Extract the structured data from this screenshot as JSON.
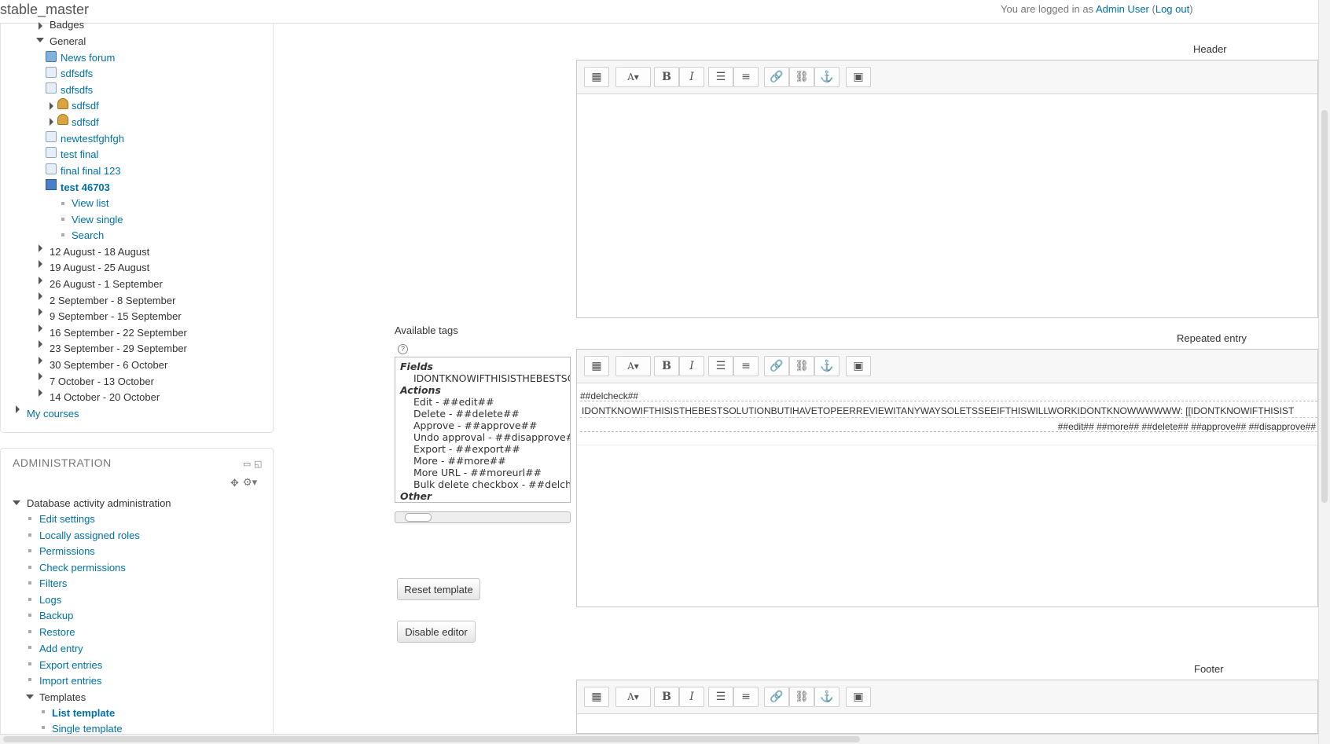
{
  "topbar": {
    "site_name": "stable_master",
    "login_prefix": "You are logged in as ",
    "user_name": "Admin User",
    "logout_open": " (",
    "logout_label": "Log out",
    "logout_close": ")"
  },
  "nav": {
    "badges": "Badges",
    "general": "General",
    "items": [
      "News forum",
      "sdfsdfs",
      "sdfsdfs",
      "sdfsdf",
      "sdfsdf",
      "newtestfghfgh",
      "test final",
      "final final 123",
      "test 46703"
    ],
    "sub_items": [
      "View list",
      "View single",
      "Search"
    ],
    "weeks": [
      "12 August - 18 August",
      "19 August - 25 August",
      "26 August - 1 September",
      "2 September - 8 September",
      "9 September - 15 September",
      "16 September - 22 September",
      "23 September - 29 September",
      "30 September - 6 October",
      "7 October - 13 October",
      "14 October - 20 October"
    ],
    "my_courses": "My courses"
  },
  "admin": {
    "title": "ADMINISTRATION",
    "section": "Database activity administration",
    "links": [
      "Edit settings",
      "Locally assigned roles",
      "Permissions",
      "Check permissions",
      "Filters",
      "Logs",
      "Backup",
      "Restore",
      "Add entry",
      "Export entries",
      "Import entries"
    ],
    "templates": "Templates",
    "template_links": [
      "List template",
      "Single template"
    ]
  },
  "main": {
    "header_label": "Header",
    "repeated_label": "Repeated entry",
    "footer_label": "Footer",
    "available_tags": "Available tags",
    "tags": {
      "fields_hdr": "Fields",
      "field_item": "IDONTKNOWIFTHISISTHEBESTSOL",
      "actions_hdr": "Actions",
      "actions": [
        "Edit - ##edit##",
        "Delete - ##delete##",
        "Approve - ##approve##",
        "Undo approval - ##disapprove##",
        "Export - ##export##",
        "More - ##more##",
        "More URL - ##moreurl##",
        "Bulk delete checkbox - ##delcheck##"
      ],
      "other_hdr": "Other"
    },
    "repeated_content": {
      "line1": "##delcheck##",
      "line2": "IDONTKNOWIFTHISISTHEBESTSOLUTIONBUTIHAVETOPEERREVIEWITANYWAYSOLETSSEEIFTHISWILLWORKIDONTKNOWWWWWW: [[IDONTKNOWIFTHISIST",
      "line3": "##edit## ##more## ##delete## ##approve## ##disapprove##"
    },
    "reset_button": "Reset template",
    "disable_editor_button": "Disable editor"
  }
}
